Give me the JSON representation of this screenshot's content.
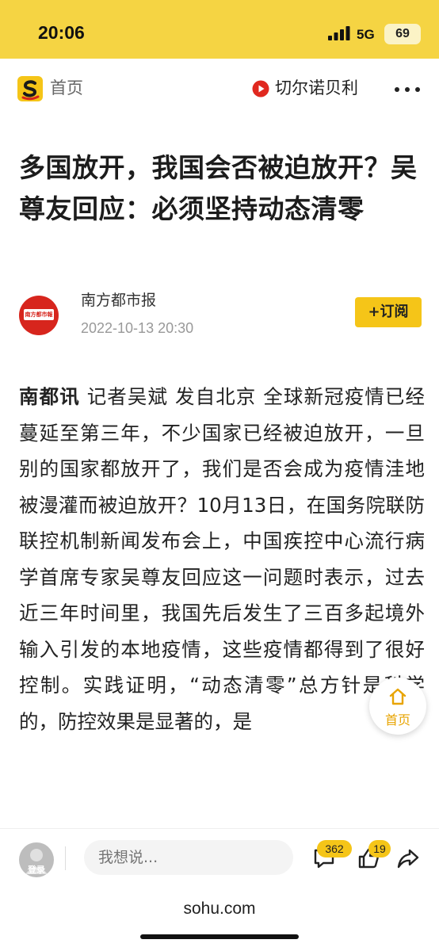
{
  "status_bar": {
    "time": "20:06",
    "network": "5G",
    "battery": "69"
  },
  "nav": {
    "logo_text": "S",
    "home_label": "首页",
    "topic_label": "切尔诺贝利"
  },
  "article": {
    "title": "多国放开，我国会否被迫放开？吴尊友回应：必须坚持动态清零",
    "author": "南方都市报",
    "avatar_text": "南方都市報",
    "date": "2022-10-13 20:30",
    "subscribe_label": "+订阅",
    "lead": "南都讯",
    "body": " 记者吴斌 发自北京 全球新冠疫情已经蔓延至第三年，不少国家已经被迫放开，一旦别的国家都放开了，我们是否会成为疫情洼地被漫灌而被迫放开？10月13日，在国务院联防联控机制新闻发布会上，中国疾控中心流行病学首席专家吴尊友回应这一问题时表示，过去近三年时间里，我国先后发生了三百多起境外输入引发的本地疫情，这些疫情都得到了很好控制。实践证明，“动态清零”总方针是科学的，防控效果是显著的，是"
  },
  "float_button": {
    "label": "首页"
  },
  "bottom_bar": {
    "login_label": "登录",
    "comment_placeholder": "我想说...",
    "comment_count": "362",
    "like_count": "19",
    "domain": "sohu.com"
  },
  "colors": {
    "accent": "#f5c518",
    "status_bg": "#f5d443",
    "video_red": "#e0281f"
  }
}
